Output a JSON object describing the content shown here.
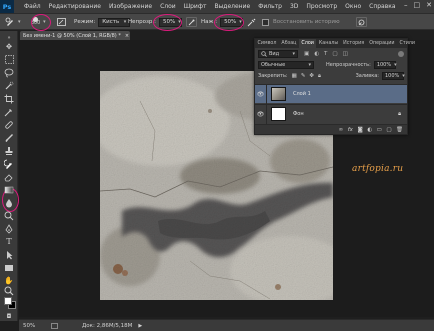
{
  "app": {
    "logo": "Ps"
  },
  "menu": [
    "Файл",
    "Редактирование",
    "Изображение",
    "Слои",
    "Шрифт",
    "Выделение",
    "Фильтр",
    "3D",
    "Просмотр",
    "Окно",
    "Справка"
  ],
  "window_controls": {
    "minimize": "–",
    "maximize": "□",
    "close": "✕"
  },
  "options": {
    "brush_size": "300",
    "mode_label": "Режим:",
    "mode_value": "Кисть",
    "opacity_label": "Непрозр.:",
    "opacity_value": "50%",
    "flow_label": "Наж.:",
    "flow_value": "50%",
    "history_label": "Восстановить историю",
    "highlight_color": "#d81b7b"
  },
  "toolbox": {
    "tools": [
      "move-tool",
      "marquee-tool",
      "lasso-tool",
      "quick-select-tool",
      "crop-tool",
      "eyedropper-tool",
      "healing-tool",
      "brush-tool",
      "clone-stamp-tool",
      "history-brush-tool",
      "eraser-tool",
      "gradient-tool",
      "blur-tool",
      "dodge-tool",
      "pen-tool",
      "type-tool",
      "path-select-tool",
      "shape-tool",
      "hand-tool",
      "zoom-tool"
    ],
    "active_tool": "history-brush-tool",
    "foreground_color": "#ffffff",
    "background_color": "#000000"
  },
  "document": {
    "tab_title": "Без имени-1 @ 50% (Слой 1, RGB/8) *",
    "close": "×"
  },
  "watermark": "artfopia.ru",
  "status": {
    "zoom": "50%",
    "doc_info": "Док: 2,86М/5,18М",
    "arrow": "▶"
  },
  "layers_panel": {
    "tabs": [
      "Символ",
      "Абзац",
      "Слои",
      "Каналы",
      "История",
      "Операции",
      "Стили"
    ],
    "active_tab": "Слои",
    "filter_label": "Вид",
    "blend_mode": "Обычные",
    "opacity_label": "Непрозрачность:",
    "opacity_value": "100%",
    "lock_label": "Закрепить:",
    "fill_label": "Заливка:",
    "fill_value": "100%",
    "layers": [
      {
        "name": "Слой 1",
        "selected": true
      },
      {
        "name": "Фон",
        "selected": false,
        "locked": true
      }
    ],
    "footer_icons": [
      "link-icon",
      "fx-icon",
      "mask-icon",
      "adjustment-icon",
      "folder-icon",
      "new-layer-icon",
      "trash-icon"
    ]
  }
}
